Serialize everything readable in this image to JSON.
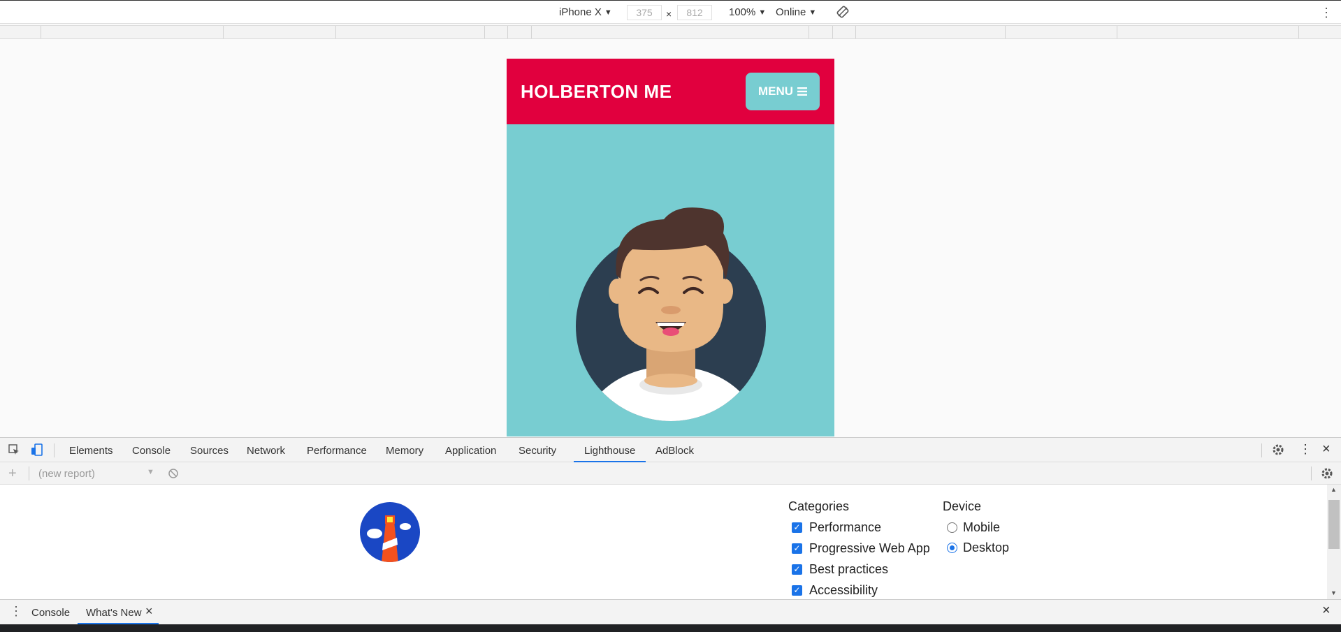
{
  "device_toolbar": {
    "device": "iPhone X",
    "width": "375",
    "height": "812",
    "times": "×",
    "zoom": "100%",
    "network": "Online",
    "rotate_icon": "rotate-icon",
    "more_icon": "kebab-icon"
  },
  "site": {
    "title": "HOLBERTON ME",
    "menu_label": "MENU",
    "menu_icon": "hamburger-icon",
    "colors": {
      "header": "#e1003e",
      "body": "#78cdd1",
      "avatar_bg": "#2c3e50"
    }
  },
  "devtools": {
    "tabs": [
      "Elements",
      "Console",
      "Sources",
      "Network",
      "Performance",
      "Memory",
      "Application",
      "Security",
      "Lighthouse",
      "AdBlock"
    ],
    "active_tab": "Lighthouse",
    "report_placeholder": "(new report)"
  },
  "lighthouse": {
    "categories_heading": "Categories",
    "categories": [
      {
        "label": "Performance",
        "checked": true
      },
      {
        "label": "Progressive Web App",
        "checked": true
      },
      {
        "label": "Best practices",
        "checked": true
      },
      {
        "label": "Accessibility",
        "checked": true
      }
    ],
    "device_heading": "Device",
    "devices": [
      {
        "label": "Mobile",
        "selected": false
      },
      {
        "label": "Desktop",
        "selected": true
      }
    ]
  },
  "drawer": {
    "tabs": [
      "Console",
      "What's New"
    ],
    "close_glyph": "×"
  }
}
